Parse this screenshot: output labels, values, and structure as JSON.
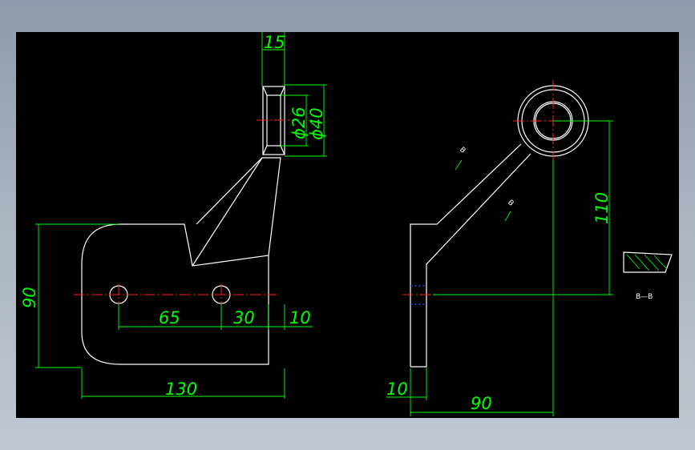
{
  "colors": {
    "background": "#000000",
    "outline": "#ffffff",
    "dimension": "#00ff00",
    "centerline": "#ff2020",
    "hidden": "#3a46ff"
  },
  "dimensions": {
    "width_15": "15",
    "dia_26": "ϕ26",
    "dia_40": "ϕ40",
    "height_90": "90",
    "dist_65": "65",
    "dist_30": "30",
    "dist_10_front": "10",
    "width_130": "130",
    "height_110": "110",
    "thick_10": "10",
    "dist_90": "90"
  },
  "section": {
    "cut_label_1": "B",
    "cut_label_2": "B",
    "view_label": "B—B"
  }
}
